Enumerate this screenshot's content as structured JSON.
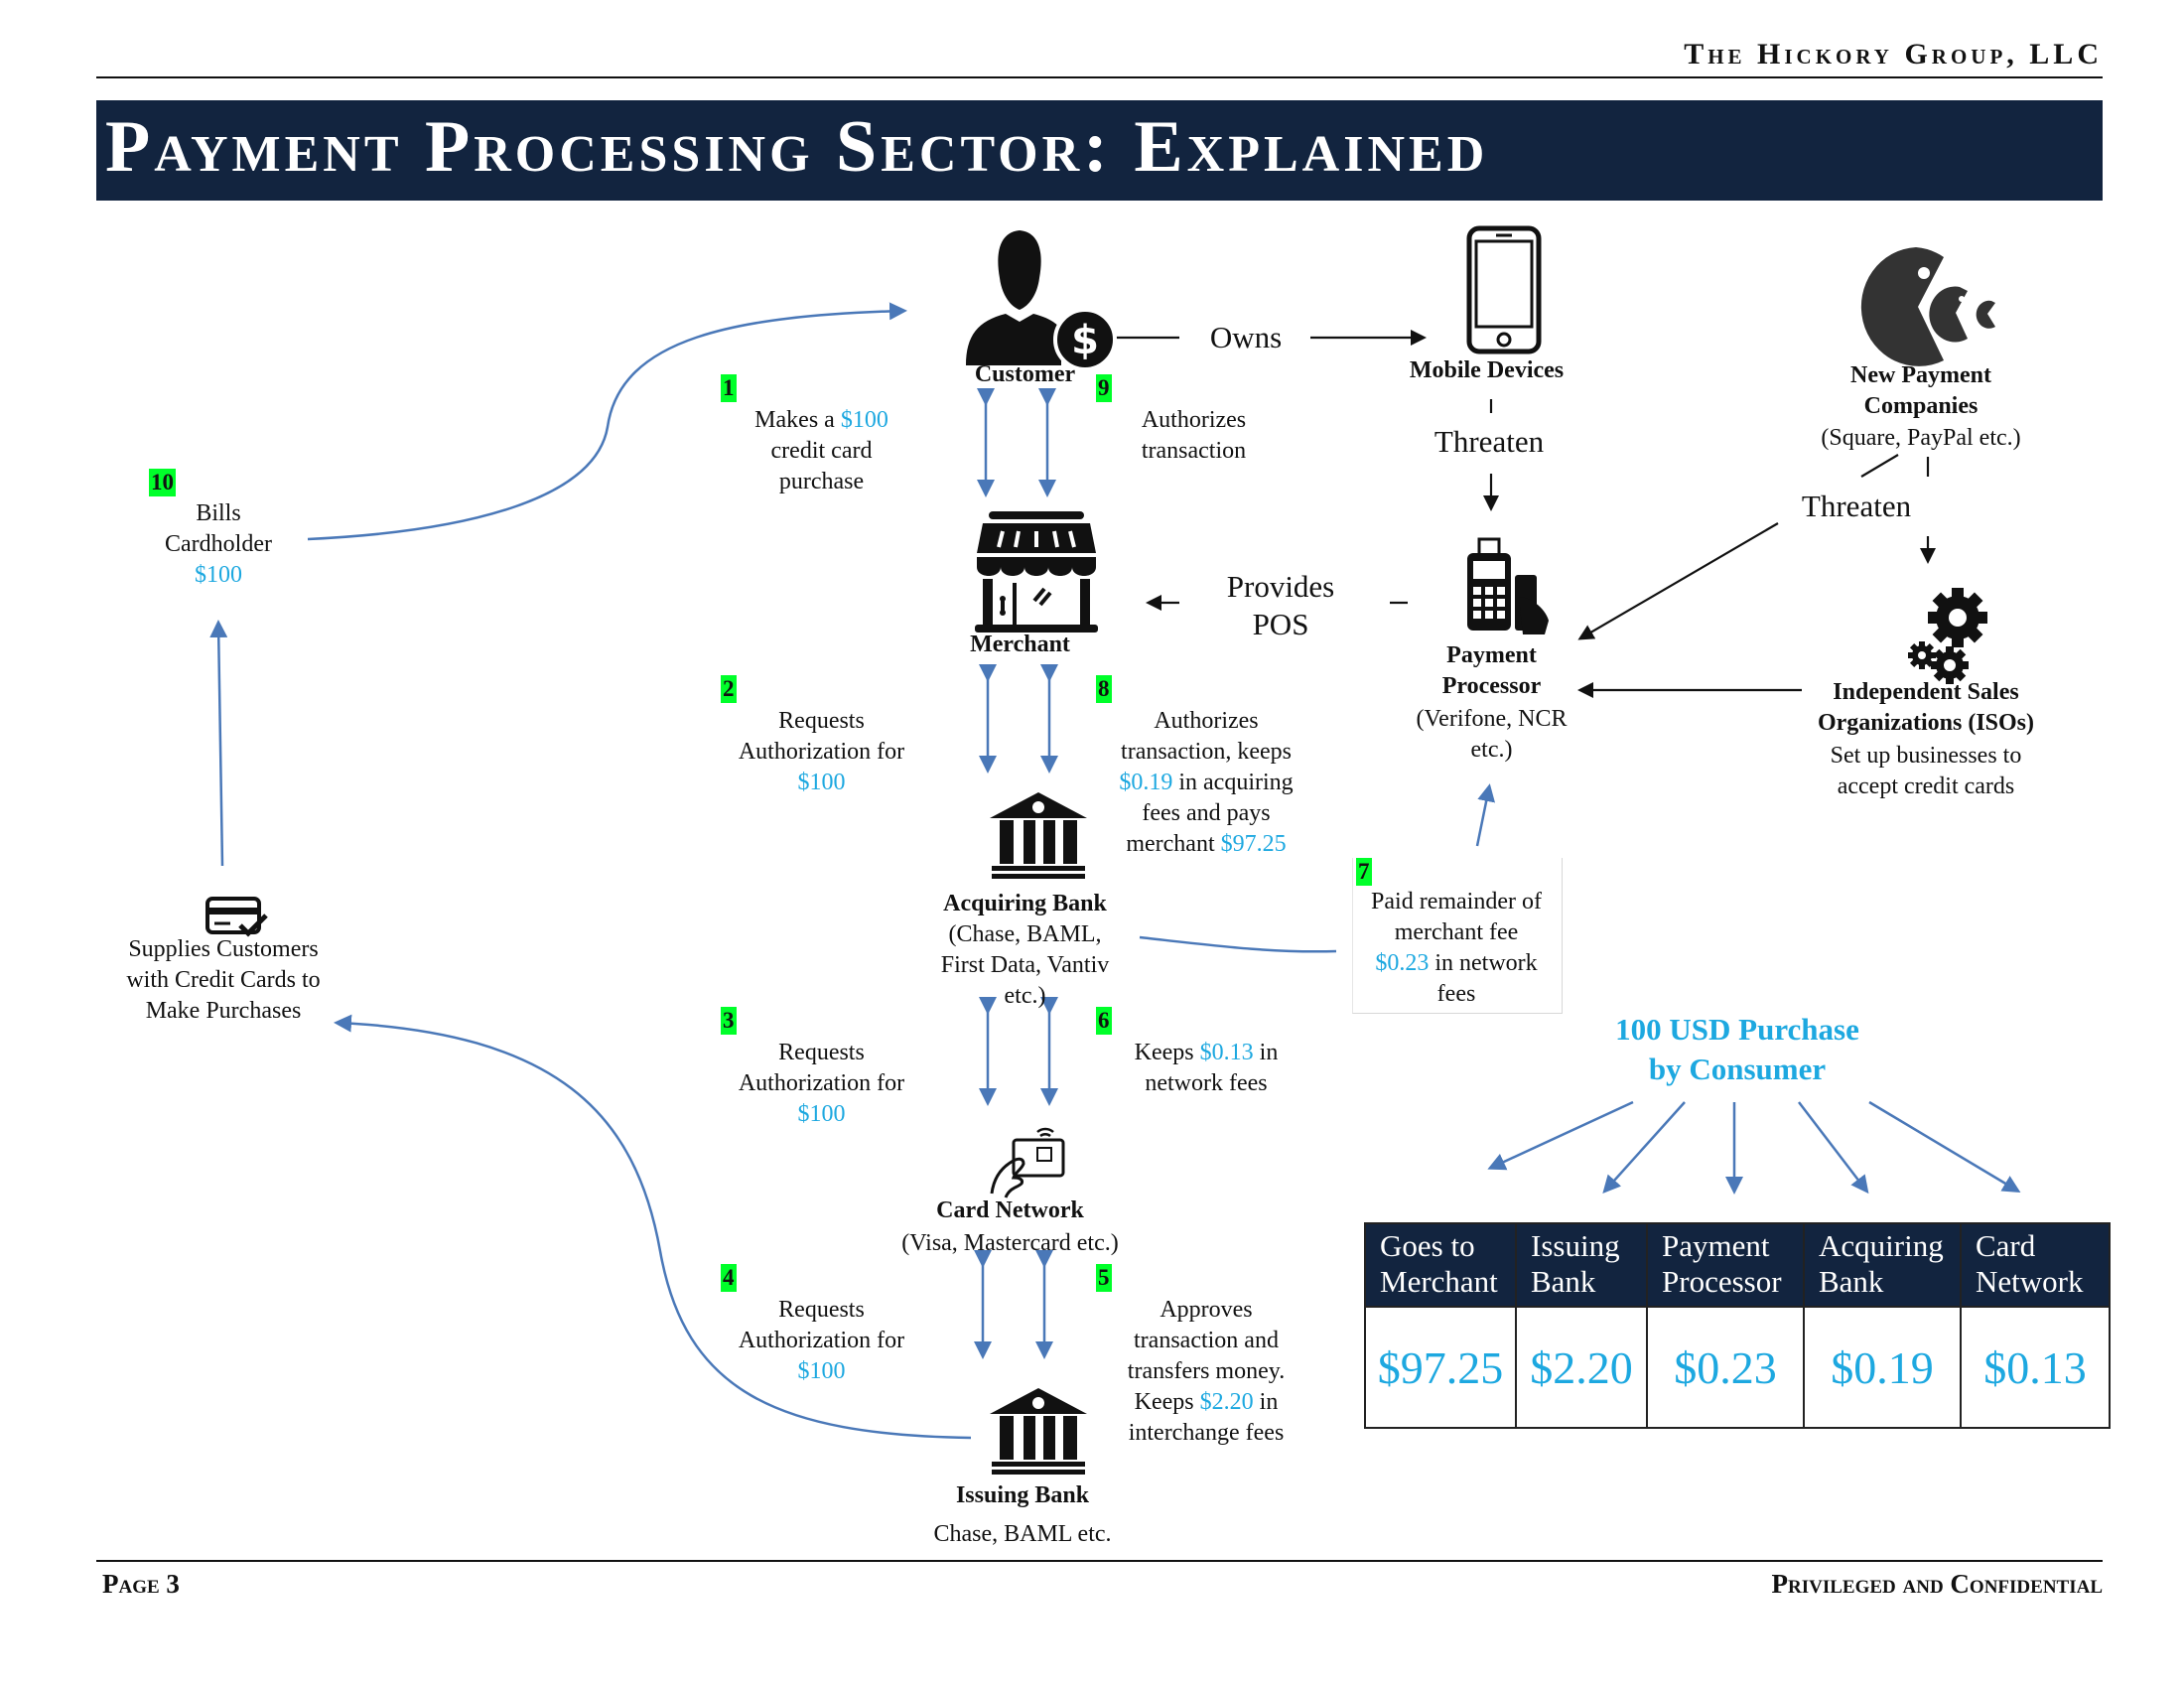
{
  "header": {
    "firm": "The Hickory Group, LLC",
    "title": "Payment Processing Sector: Explained"
  },
  "nodes": {
    "customer": {
      "label": "Customer"
    },
    "merchant": {
      "label": "Merchant"
    },
    "acquiring_bank": {
      "label": "Acquiring Bank",
      "lines": [
        "(Chase, BAML,",
        "First Data, Vantiv",
        "etc.)"
      ]
    },
    "card_network": {
      "label": "Card Network",
      "sub": "(Visa, Mastercard etc.)"
    },
    "issuing_bank": {
      "label": "Issuing Bank",
      "sub": "Chase, BAML etc."
    },
    "mobile_devices": {
      "label": "Mobile Devices"
    },
    "payment_processor": {
      "label_1": "Payment",
      "label_2": "Processor",
      "sub_1": "(Verifone, NCR",
      "sub_2": "etc.)"
    },
    "new_payment_companies": {
      "label_1": "New Payment",
      "label_2": "Companies",
      "sub": "(Square, PayPal etc.)"
    },
    "isos": {
      "label_1": "Independent Sales",
      "label_2": "Organizations (ISOs)",
      "sub_1": "Set up businesses to",
      "sub_2": "accept credit cards"
    }
  },
  "relations": {
    "owns": "Owns",
    "threaten_mobile": "Threaten",
    "threaten_new": "Threaten",
    "provides_1": "Provides",
    "provides_2": "POS"
  },
  "steps": {
    "s1": {
      "num": "1",
      "l1_pre": "Makes a ",
      "l1_amt": "$100",
      "l2": "credit card",
      "l3": "purchase"
    },
    "s2": {
      "num": "2",
      "l1": "Requests",
      "l2": "Authorization for",
      "amt": "$100"
    },
    "s3": {
      "num": "3",
      "l1": "Requests",
      "l2": "Authorization for",
      "amt": "$100"
    },
    "s4": {
      "num": "4",
      "l1": "Requests",
      "l2": "Authorization for",
      "amt": "$100"
    },
    "s5": {
      "num": "5",
      "l1": "Approves",
      "l2": "transaction and",
      "l3": "transfers money.",
      "l4_pre": "Keeps ",
      "l4_amt": "$2.20",
      "l4_post": " in",
      "l5": "interchange fees"
    },
    "s6": {
      "num": "6",
      "l1_pre": "Keeps ",
      "l1_amt": "$0.13",
      "l1_post": " in",
      "l2": "network fees"
    },
    "s7": {
      "num": "7",
      "l1": "Paid remainder of",
      "l2": "merchant fee",
      "l3_amt": "$0.23",
      "l3_post": " in network",
      "l4": "fees"
    },
    "s8": {
      "num": "8",
      "l1": "Authorizes",
      "l2": "transaction, keeps",
      "l3_amt": "$0.19",
      "l3_post": " in acquiring",
      "l4": "fees and pays",
      "l5_pre": "merchant ",
      "l5_amt": "$97.25"
    },
    "s9": {
      "num": "9",
      "l1": "Authorizes",
      "l2": "transaction"
    },
    "s10": {
      "num": "10",
      "l1": "Bills",
      "l2": "Cardholder",
      "amt": "$100"
    }
  },
  "supplies": {
    "l1": "Supplies Customers",
    "l2": "with Credit Cards to",
    "l3": "Make Purchases"
  },
  "breakdown": {
    "title_1": "100 USD Purchase",
    "title_2": "by Consumer",
    "columns": [
      {
        "h1": "Goes to",
        "h2": "Merchant",
        "value": "$97.25"
      },
      {
        "h1": "Issuing",
        "h2": "Bank",
        "value": "$2.20"
      },
      {
        "h1": "Payment",
        "h2": "Processor",
        "value": "$0.23"
      },
      {
        "h1": "Acquiring",
        "h2": "Bank",
        "value": "$0.19"
      },
      {
        "h1": "Card",
        "h2": "Network",
        "value": "$0.13"
      }
    ]
  },
  "footer": {
    "page": "Page 3",
    "confidential": "Privileged and Confidential"
  },
  "colors": {
    "navy": "#12243f",
    "accent_blue": "#1da8e0",
    "arrow_blue": "#4a78b8",
    "badge_green": "#00ff2a"
  }
}
